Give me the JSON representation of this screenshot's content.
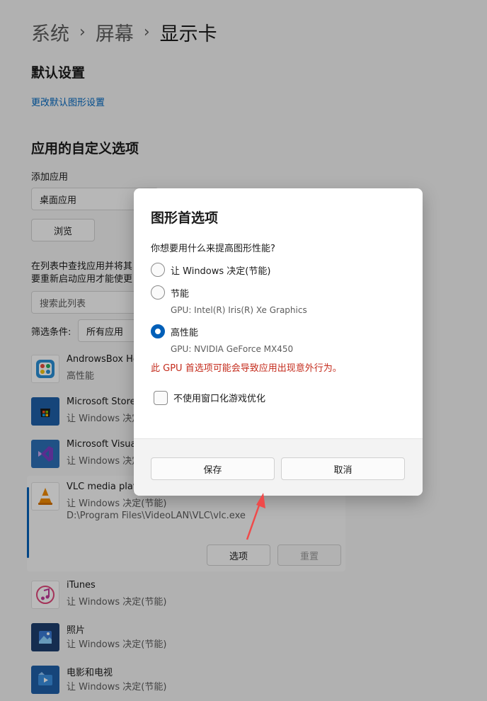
{
  "breadcrumb": {
    "level1": "系统",
    "level2": "屏幕",
    "current": "显示卡",
    "separator": "›"
  },
  "default_settings": {
    "heading": "默认设置",
    "link": "更改默认图形设置"
  },
  "custom_options": {
    "heading": "应用的自定义选项",
    "add_app_label": "添加应用",
    "app_type_value": "桌面应用",
    "browse_button": "浏览",
    "description_line1": "在列表中查找应用并将其",
    "description_line2": "要重新启动应用才能使更",
    "search_placeholder": "搜索此列表",
    "filter_label": "筛选条件:",
    "filter_value": "所有应用"
  },
  "apps": [
    {
      "name": "AndrowsBox Helper",
      "status": "高性能",
      "icon": "androwsbox-icon"
    },
    {
      "name": "Microsoft Store",
      "status": "让 Windows 决定(节能)",
      "icon": "store-icon"
    },
    {
      "name": "Microsoft Visual Studio",
      "status": "让 Windows 决定(节能)",
      "icon": "visual-studio-icon"
    },
    {
      "name": "VLC media player",
      "status": "让 Windows 决定(节能)",
      "path": "D:\\Program Files\\VideoLAN\\VLC\\vlc.exe",
      "icon": "vlc-icon",
      "options_button": "选项",
      "reset_button": "重置"
    },
    {
      "name": "iTunes",
      "status": "让 Windows 决定(节能)",
      "icon": "itunes-icon"
    },
    {
      "name": "照片",
      "status": "让 Windows 决定(节能)",
      "icon": "photos-icon"
    },
    {
      "name": "电影和电视",
      "status": "让 Windows 决定(节能)",
      "icon": "movies-tv-icon"
    }
  ],
  "dialog": {
    "title": "图形首选项",
    "question": "你想要用什么来提高图形性能?",
    "options": [
      {
        "label": "让 Windows 决定(节能)",
        "selected": false
      },
      {
        "label": "节能",
        "sub": "GPU: Intel(R) Iris(R) Xe Graphics",
        "selected": false
      },
      {
        "label": "高性能",
        "sub": "GPU: NVIDIA GeForce MX450",
        "selected": true
      }
    ],
    "warning": "此 GPU 首选项可能会导致应用出现意外行为。",
    "checkbox_label": "不使用窗口化游戏优化",
    "save_button": "保存",
    "cancel_button": "取消"
  },
  "colors": {
    "accent": "#005fb8",
    "link": "#0067c0",
    "warning": "#c42b1c",
    "arrow": "#f04a4a"
  }
}
